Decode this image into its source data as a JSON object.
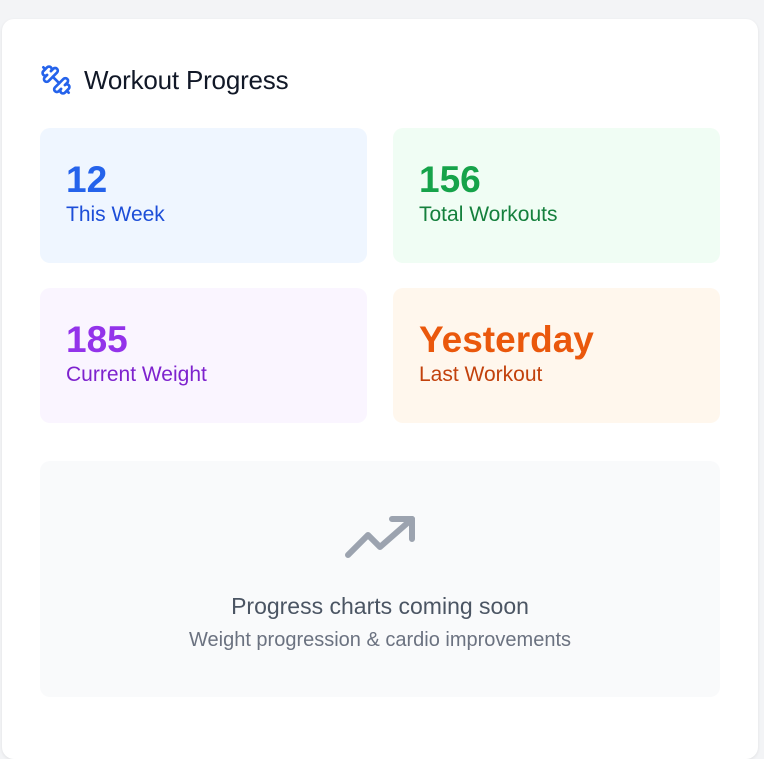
{
  "header": {
    "title": "Workout Progress",
    "icon": "dumbbell-icon"
  },
  "stats": [
    {
      "value": "12",
      "label": "This Week",
      "value_color": "#2563eb",
      "label_color": "#1d4ed8",
      "bg": "#eff6ff"
    },
    {
      "value": "156",
      "label": "Total Workouts",
      "value_color": "#16a34a",
      "label_color": "#15803d",
      "bg": "#f0fdf4"
    },
    {
      "value": "185",
      "label": "Current Weight",
      "value_color": "#9333ea",
      "label_color": "#7e22ce",
      "bg": "#faf5ff"
    },
    {
      "value": "Yesterday",
      "label": "Last Workout",
      "value_color": "#ea580c",
      "label_color": "#c2410c",
      "bg": "#fff7ed"
    }
  ],
  "placeholder": {
    "icon": "trending-up-icon",
    "title": "Progress charts coming soon",
    "subtitle": "Weight progression & cardio improvements"
  }
}
